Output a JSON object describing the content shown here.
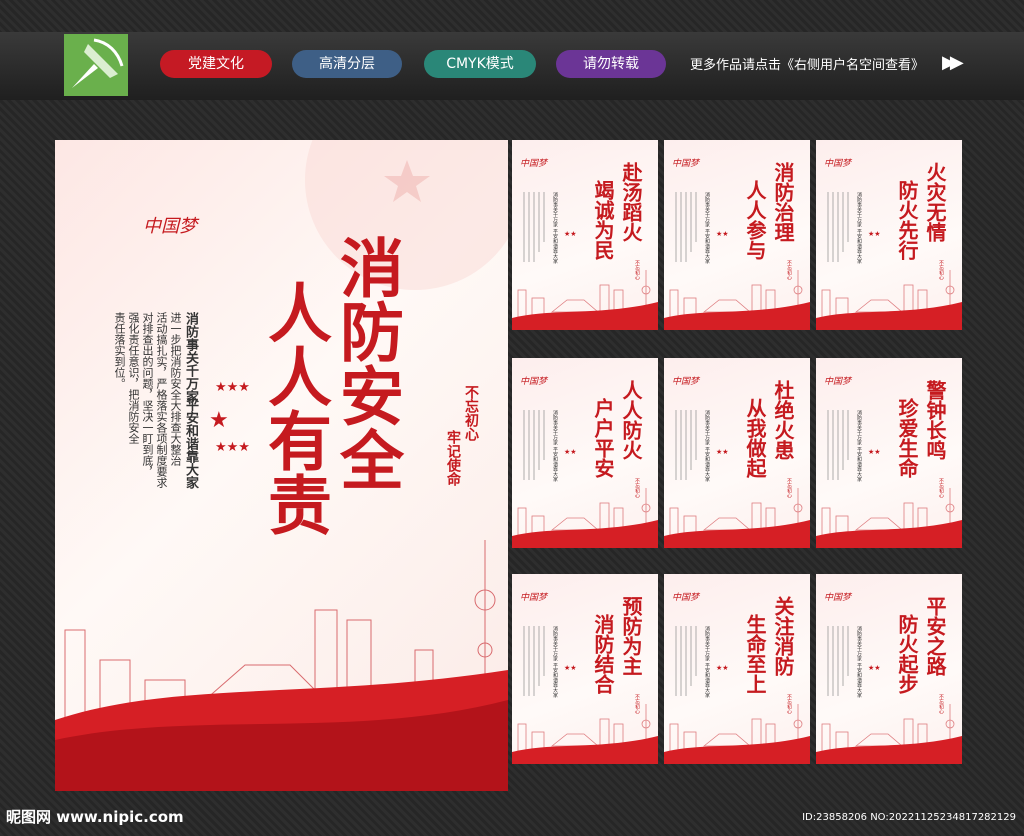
{
  "header": {
    "pills": [
      {
        "label": "党建文化",
        "color": "#c51a24"
      },
      {
        "label": "高清分层",
        "color": "#3e5f86"
      },
      {
        "label": "CMYK模式",
        "color": "#2a8778"
      },
      {
        "label": "请勿转载",
        "color": "#6b3596"
      }
    ],
    "promo_text": "更多作品请点击《右侧用户名空间查看》"
  },
  "main_poster": {
    "title_col1": "消防安全",
    "title_col2": "人人有责",
    "badge_col1": "不忘初心",
    "badge_col2": "牢记使命",
    "slogan_col1": "消防事关千万家",
    "slogan_col2": "平安和谐靠大家",
    "body_cols": [
      "进一步把消防安全大排查大整治",
      "活动搞扎实，严格落实各项制度要求",
      "对排查出的问题，坚决一盯到底，",
      "强化责任意识，把消防安全",
      "责任落实到位。"
    ],
    "logo_text": "中国梦"
  },
  "small_posters": [
    {
      "line1": "赴汤蹈火",
      "line2": "竭诚为民"
    },
    {
      "line1": "消防治理",
      "line2": "人人参与"
    },
    {
      "line1": "火灾无情",
      "line2": "防火先行"
    },
    {
      "line1": "人人防火",
      "line2": "户户平安"
    },
    {
      "line1": "杜绝火患",
      "line2": "从我做起"
    },
    {
      "line1": "警钟长鸣",
      "line2": "珍爱生命"
    },
    {
      "line1": "预防为主",
      "line2": "消防结合"
    },
    {
      "line1": "关注消防",
      "line2": "生命至上"
    },
    {
      "line1": "平安之路",
      "line2": "防火起步"
    }
  ],
  "small_slogan": "消防事关千万家 平安和谐靠大家",
  "footer": {
    "site": "昵图网 www.nipic.com",
    "id_text": "ID:23858206 NO:20221125234817282129"
  },
  "colors": {
    "accent_red": "#c51a1f",
    "wave_red": "#d61f25"
  }
}
